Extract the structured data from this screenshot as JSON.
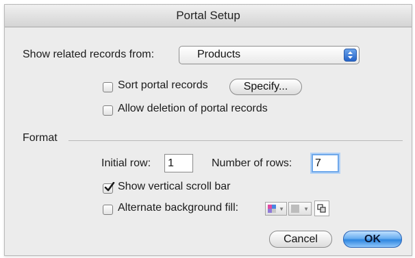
{
  "window": {
    "title": "Portal Setup"
  },
  "related": {
    "label": "Show related records from:",
    "selected": "Products"
  },
  "options": {
    "sort_label": "Sort portal records",
    "sort_checked": false,
    "specify_label": "Specify...",
    "allow_deletion_label": "Allow deletion of portal records",
    "allow_deletion_checked": false
  },
  "format": {
    "section_label": "Format",
    "initial_row_label": "Initial row:",
    "initial_row_value": "1",
    "number_of_rows_label": "Number of rows:",
    "number_of_rows_value": "7",
    "scroll_bar_label": "Show vertical scroll bar",
    "scroll_bar_checked": true,
    "alt_fill_label": "Alternate background fill:",
    "alt_fill_checked": false
  },
  "buttons": {
    "cancel": "Cancel",
    "ok": "OK"
  },
  "colors": {
    "accent": "#2e86e0",
    "popup_arrows": "#2563c8",
    "focus_ring": "#6fa8ea"
  }
}
